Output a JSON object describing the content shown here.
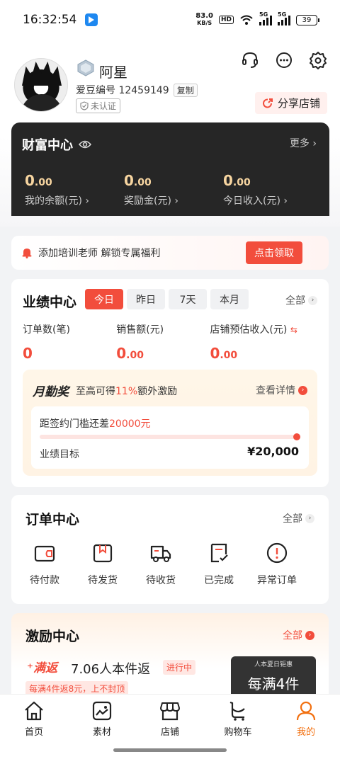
{
  "status_bar": {
    "time": "16:32:54",
    "net_speed": "83.0",
    "net_unit": "KB/S",
    "hd": "HD",
    "sig1": "5G",
    "sig2": "5G",
    "battery": "39"
  },
  "profile": {
    "nickname": "阿星",
    "id_label": "爱豆编号 12459149",
    "copy_label": "复制",
    "verify_label": "未认证",
    "share_label": "分享店铺"
  },
  "wealth": {
    "title": "财富中心",
    "more_label": "更多",
    "items": [
      {
        "value_int": "0",
        "value_dec": ".00",
        "label": "我的余额(元)"
      },
      {
        "value_int": "0",
        "value_dec": ".00",
        "label": "奖励金(元)"
      },
      {
        "value_int": "0",
        "value_dec": ".00",
        "label": "今日收入(元)"
      }
    ]
  },
  "banner": {
    "text": "添加培训老师 解锁专属福利",
    "button": "点击领取"
  },
  "performance": {
    "title": "业绩中心",
    "tabs": [
      "今日",
      "昨日",
      "7天",
      "本月"
    ],
    "active_tab": 0,
    "all_label": "全部",
    "stats": [
      {
        "label": "订单数(笔)",
        "value_int": "0",
        "value_dec": ""
      },
      {
        "label": "销售额(元)",
        "value_int": "0",
        "value_dec": ".00"
      },
      {
        "label": "店铺预估收入(元)",
        "value_int": "0",
        "value_dec": ".00"
      }
    ],
    "bonus": {
      "logo": "月勤奖",
      "text_pre": "至高可得",
      "text_hl": "11%",
      "text_post": "额外激励",
      "detail_label": "查看详情",
      "gap_pre": "距签约门槛还差",
      "gap_hl": "20000元",
      "goal_label": "业绩目标",
      "goal_value": "¥20,000",
      "progress": 1.0
    }
  },
  "orders": {
    "title": "订单中心",
    "all_label": "全部",
    "items": [
      {
        "label": "待付款",
        "icon": "wallet-icon"
      },
      {
        "label": "待发货",
        "icon": "gift-box-icon"
      },
      {
        "label": "待收货",
        "icon": "truck-icon"
      },
      {
        "label": "已完成",
        "icon": "checked-doc-icon"
      },
      {
        "label": "异常订单",
        "icon": "alert-icon"
      }
    ]
  },
  "incentive": {
    "title": "激励中心",
    "all_label": "全部",
    "tag": "满返",
    "name": "7.06人本件返",
    "status": "进行中",
    "note": "每满4件返8元，上不封顶",
    "poster_small": "人本夏日钜惠",
    "poster_large": "每满4件"
  },
  "tabbar": {
    "items": [
      {
        "label": "首页",
        "icon": "home-icon"
      },
      {
        "label": "素材",
        "icon": "image-icon"
      },
      {
        "label": "店铺",
        "icon": "store-icon"
      },
      {
        "label": "购物车",
        "icon": "cart-icon"
      },
      {
        "label": "我的",
        "icon": "person-icon"
      }
    ],
    "active": 4
  },
  "colors": {
    "accent": "#f24d3c",
    "gold": "#f7d5a0",
    "tab_active": "#f27010"
  }
}
